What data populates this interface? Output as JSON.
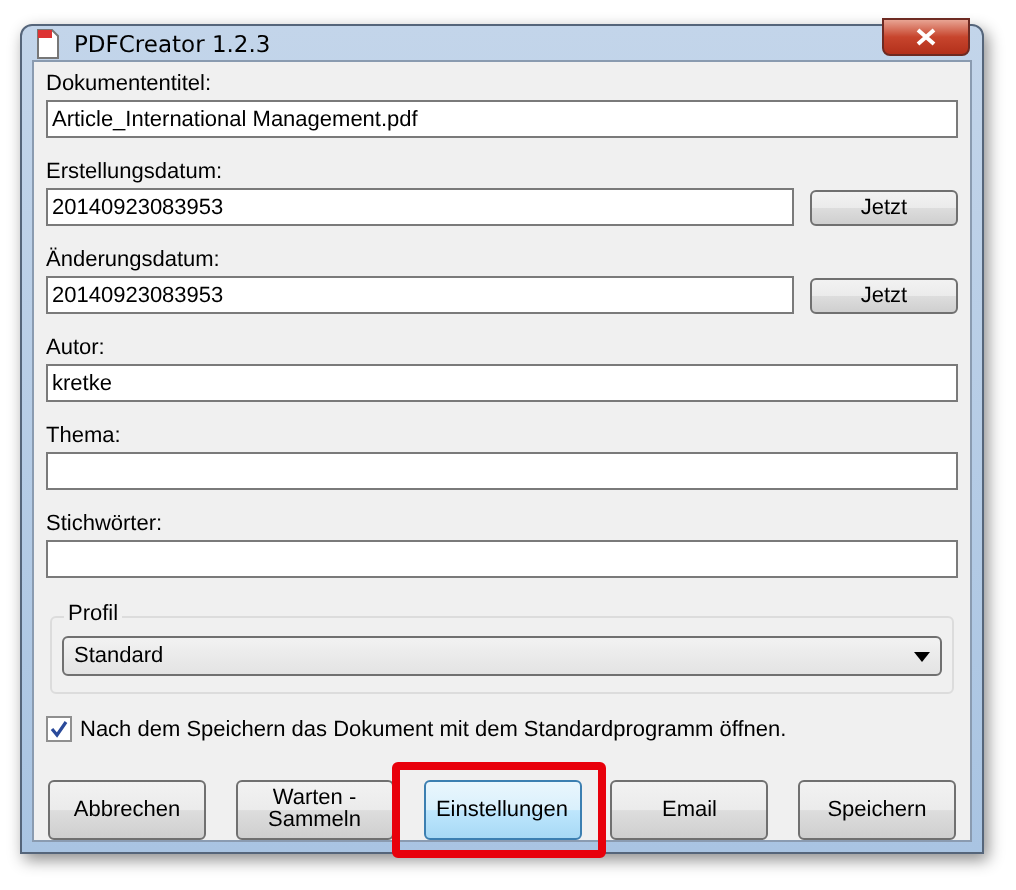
{
  "window": {
    "title": "PDFCreator 1.2.3"
  },
  "fields": [
    {
      "label": "Dokumententitel:",
      "value": "Article_International Management.pdf"
    },
    {
      "label": "Erstellungsdatum:",
      "value": "20140923083953",
      "button": "Jetzt"
    },
    {
      "label": "Änderungsdatum:",
      "value": "20140923083953",
      "button": "Jetzt"
    },
    {
      "label": "Autor:",
      "value": "kretke"
    },
    {
      "label": "Thema:"
    },
    {
      "label": "Stichwörter:"
    }
  ],
  "profile": {
    "legend": "Profil",
    "value": "Standard"
  },
  "open_after_save": {
    "label": "Nach dem Speichern das Dokument mit dem Standardprogramm öffnen.",
    "checked": true
  },
  "buttons": [
    {
      "label": "Abbrechen",
      "highlighted": false
    },
    {
      "label": "Warten -\nSammeln",
      "highlighted": false
    },
    {
      "label": "Einstellungen",
      "highlighted": true
    },
    {
      "label": "Email",
      "highlighted": false
    },
    {
      "label": "Speichern",
      "highlighted": false
    }
  ]
}
